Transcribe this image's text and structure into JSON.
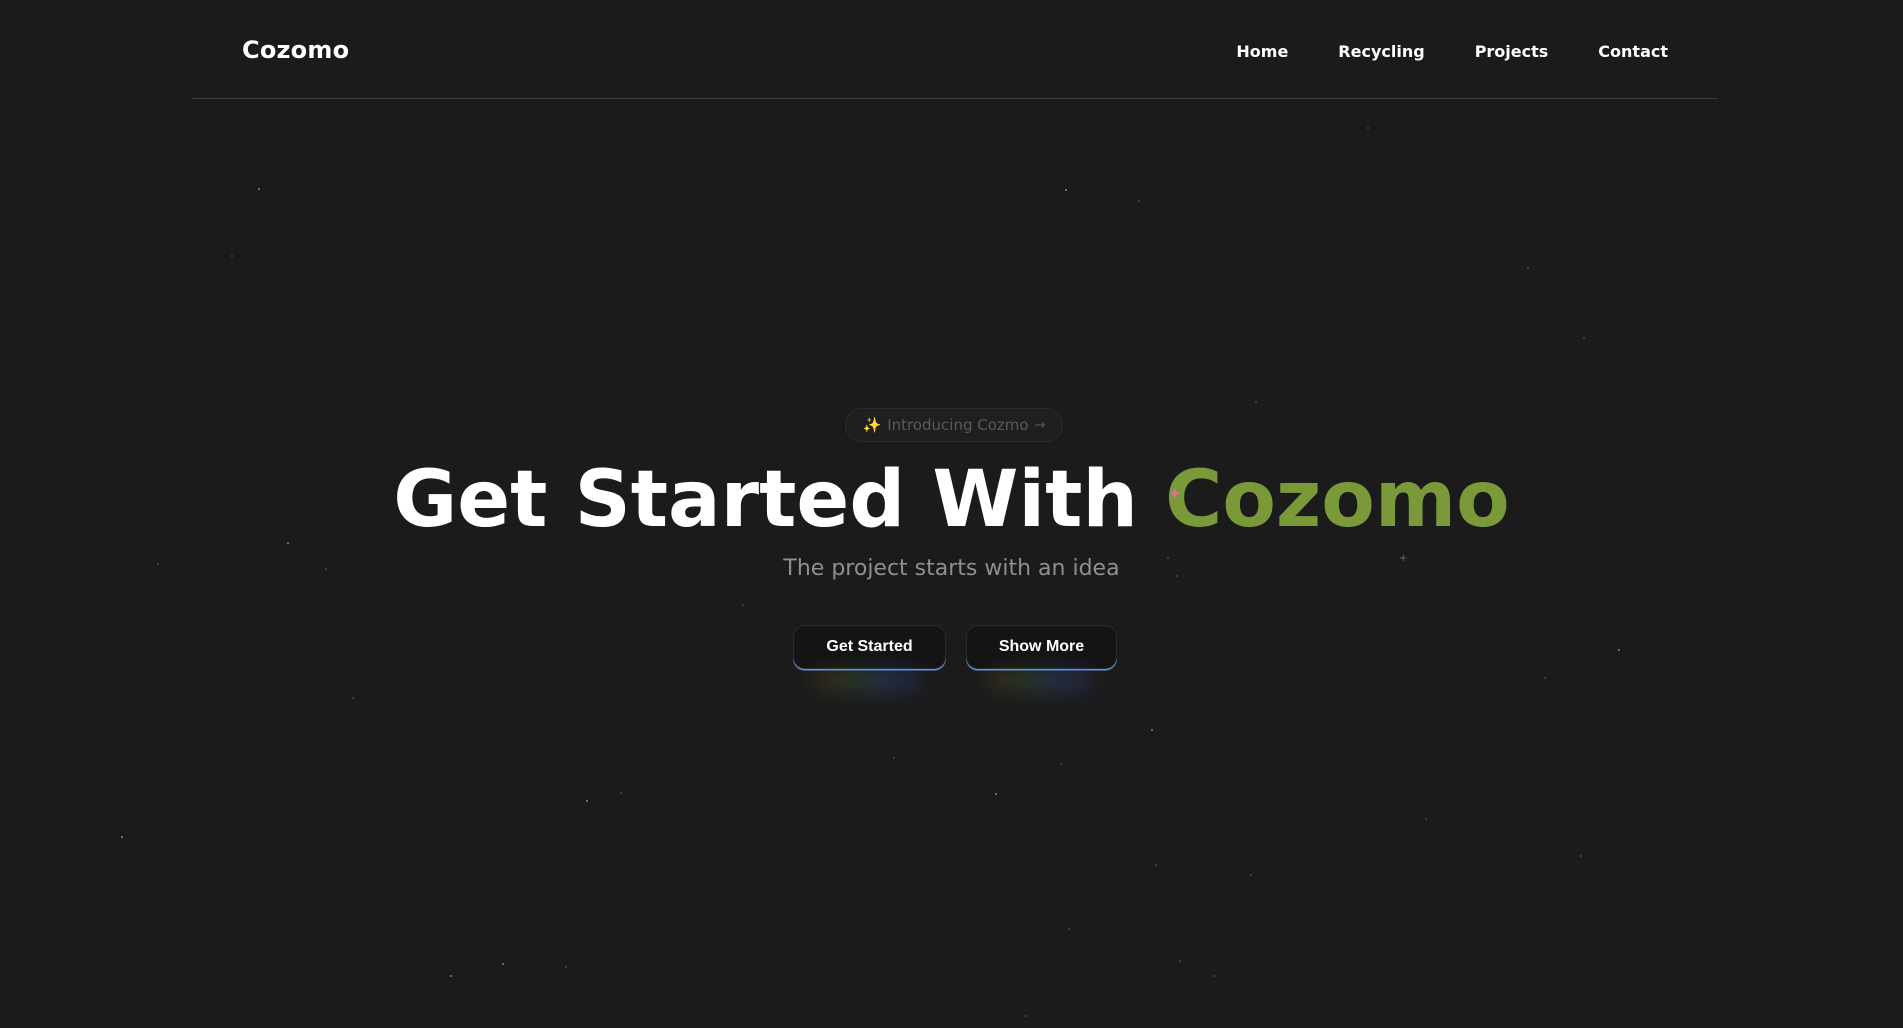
{
  "nav": {
    "brand": "Cozomo",
    "links": [
      "Home",
      "Recycling",
      "Projects",
      "Contact"
    ]
  },
  "hero": {
    "badge": "Introducing Cozmo",
    "badge_icon": "sparkles-icon",
    "badge_arrow": "→",
    "headline_prefix": "Get Started With",
    "headline_accent": "Cozomo",
    "subtitle": "The project starts with an idea",
    "primary_button": "Get Started",
    "secondary_button": "Show More"
  },
  "colors": {
    "background": "#1b1b1b",
    "accent": "#7a9a3a",
    "text": "#ffffff",
    "muted": "#8f8f8f"
  }
}
